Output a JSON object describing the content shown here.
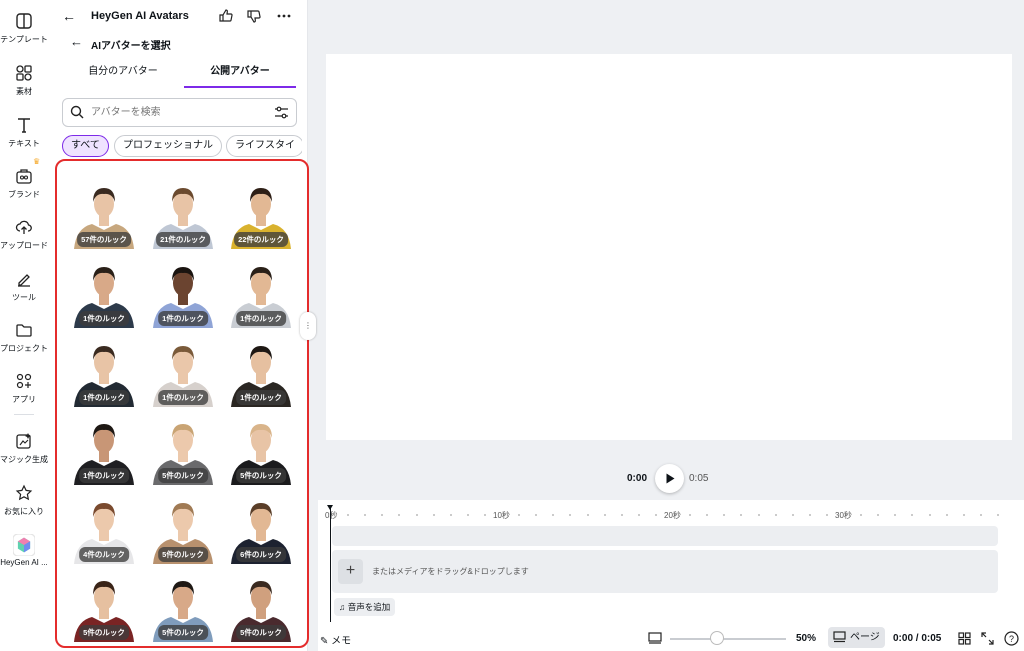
{
  "rail": {
    "items": [
      {
        "label": "テンプレート",
        "icon": "template-icon"
      },
      {
        "label": "素材",
        "icon": "elements-icon"
      },
      {
        "label": "テキスト",
        "icon": "text-icon"
      },
      {
        "label": "ブランド",
        "icon": "brand-icon"
      },
      {
        "label": "アップロード",
        "icon": "upload-icon"
      },
      {
        "label": "ツール",
        "icon": "draw-icon"
      },
      {
        "label": "プロジェクト",
        "icon": "folder-icon"
      },
      {
        "label": "アプリ",
        "icon": "apps-icon"
      },
      {
        "label": "マジック生成",
        "icon": "magic-icon"
      },
      {
        "label": "お気に入り",
        "icon": "star-icon"
      },
      {
        "label": "HeyGen AI ...",
        "icon": "heygen-app-icon"
      }
    ]
  },
  "panel": {
    "title": "HeyGen AI Avatars",
    "subtitle": "AIアバターを選択",
    "tabs": [
      "自分のアバター",
      "公開アバター"
    ],
    "active_tab": "公開アバター",
    "search_placeholder": "アバターを検索",
    "chips": [
      "すべて",
      "プロフェッショナル",
      "ライフスタイ"
    ],
    "selected_chip": "すべて",
    "avatars": [
      {
        "looks": "57件のルック",
        "skin": "#e8c4a6",
        "hair": "#3a2a20",
        "top": "#c7a77e"
      },
      {
        "looks": "21件のルック",
        "skin": "#e8c4a6",
        "hair": "#6b4a2e",
        "top": "#bfc7d4"
      },
      {
        "looks": "22件のルック",
        "skin": "#e2b894",
        "hair": "#2e1f16",
        "top": "#d9b22e"
      },
      {
        "looks": "1件のルック",
        "skin": "#d8a988",
        "hair": "#2a2018",
        "top": "#2d3a4a"
      },
      {
        "looks": "1件のルック",
        "skin": "#6b4430",
        "hair": "#1a1410",
        "top": "#8fa4d6"
      },
      {
        "looks": "1件のルック",
        "skin": "#e2b894",
        "hair": "#2a2018",
        "top": "#c9cdd3"
      },
      {
        "looks": "1件のルック",
        "skin": "#e8c4a6",
        "hair": "#3a2a20",
        "top": "#222a33"
      },
      {
        "looks": "1件のルック",
        "skin": "#eac7aa",
        "hair": "#7a5a3a",
        "top": "#d6d0cc"
      },
      {
        "looks": "1件のルック",
        "skin": "#e6c0a0",
        "hair": "#1e1814",
        "top": "#2a2622"
      },
      {
        "looks": "1件のルック",
        "skin": "#c89676",
        "hair": "#1e1814",
        "top": "#1f1f22"
      },
      {
        "looks": "5件のルック",
        "skin": "#ecc9ac",
        "hair": "#c9a474",
        "top": "#6a6a6c"
      },
      {
        "looks": "5件のルック",
        "skin": "#e8c4a6",
        "hair": "#d9b48a",
        "top": "#1b1b1d"
      },
      {
        "looks": "4件のルック",
        "skin": "#ecc9ac",
        "hair": "#7a4a2e",
        "top": "#e6e6e8"
      },
      {
        "looks": "5件のルック",
        "skin": "#ecc9ac",
        "hair": "#a07a54",
        "top": "#b8916e"
      },
      {
        "looks": "6件のルック",
        "skin": "#e2b894",
        "hair": "#5a3e28",
        "top": "#1d2230"
      },
      {
        "looks": "5件のルック",
        "skin": "#e6c0a0",
        "hair": "#3a2418",
        "top": "#7a2424"
      },
      {
        "looks": "5件のルック",
        "skin": "#d8a988",
        "hair": "#1e1814",
        "top": "#7f9cbc"
      },
      {
        "looks": "5件のルック",
        "skin": "#d0a07e",
        "hair": "#3a2a20",
        "top": "#4a2a2e"
      }
    ]
  },
  "player": {
    "current": "0:00",
    "total": "0:05"
  },
  "timeline": {
    "ticks": [
      "0秒",
      "10秒",
      "20秒",
      "30秒"
    ],
    "drop_hint": "またはメディアをドラッグ&ドロップします",
    "add_audio": "音声を追加"
  },
  "footer": {
    "memo": "メモ",
    "zoom": "50%",
    "page_label": "ページ",
    "timecode": "0:00 / 0:05"
  },
  "colors": {
    "accent": "#7d2ae8",
    "highlight": "#e42c2c"
  }
}
